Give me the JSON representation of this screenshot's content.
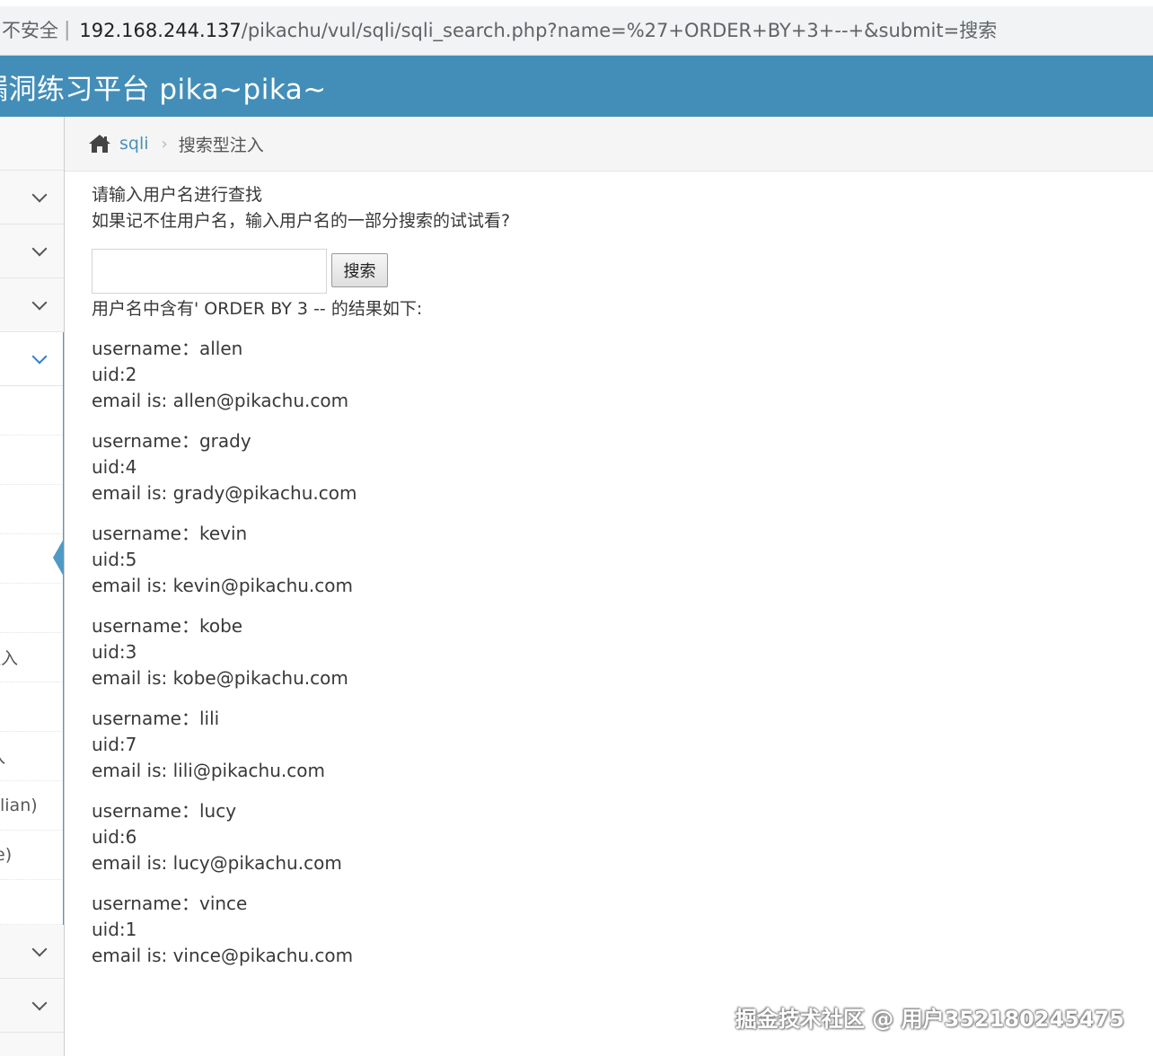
{
  "browser": {
    "security_label": "不安全",
    "url_host": "192.168.244.137",
    "url_path": "/pikachu/vul/sqli/sqli_search.php?name=%27+ORDER+BY+3+--+&submit=搜索"
  },
  "header": {
    "title": "漏洞练习平台 pika~pika~"
  },
  "sidebar": {
    "partial_labels": [
      "注入",
      "入",
      "lian)",
      "e)"
    ]
  },
  "breadcrumb": {
    "section": "sqli",
    "current": "搜索型注入"
  },
  "main": {
    "prompt_line1": "请输入用户名进行查找",
    "prompt_line2": "如果记不住用户名，输入用户名的一部分搜索的试试看?",
    "search_value": "",
    "search_button": "搜索",
    "result_heading": "用户名中含有' ORDER BY 3 -- 的结果如下:",
    "results": [
      {
        "username": "username：allen",
        "uid": "uid:2",
        "email": "email is: allen@pikachu.com"
      },
      {
        "username": "username：grady",
        "uid": "uid:4",
        "email": "email is: grady@pikachu.com"
      },
      {
        "username": "username：kevin",
        "uid": "uid:5",
        "email": "email is: kevin@pikachu.com"
      },
      {
        "username": "username：kobe",
        "uid": "uid:3",
        "email": "email is: kobe@pikachu.com"
      },
      {
        "username": "username：lili",
        "uid": "uid:7",
        "email": "email is: lili@pikachu.com"
      },
      {
        "username": "username：lucy",
        "uid": "uid:6",
        "email": "email is: lucy@pikachu.com"
      },
      {
        "username": "username：vince",
        "uid": "uid:1",
        "email": "email is: vince@pikachu.com"
      }
    ]
  },
  "watermark": "掘金技术社区 @ 用户352180245475",
  "colors": {
    "header_bg": "#438eb9",
    "link": "#4c8fbd",
    "active_bar": "#4f99c6"
  }
}
